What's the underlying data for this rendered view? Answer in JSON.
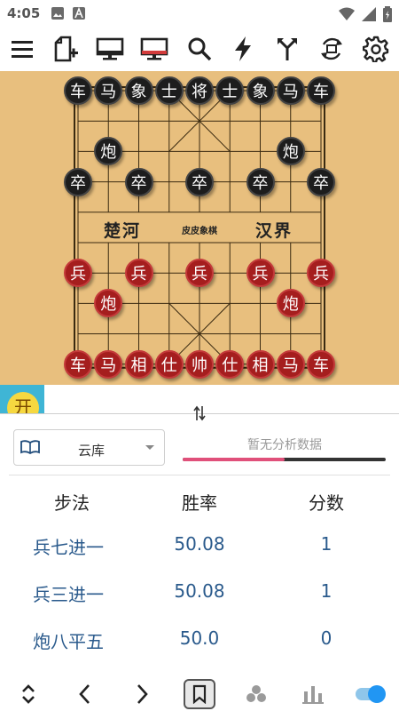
{
  "status_bar": {
    "time": "4:05",
    "left_icons": [
      "image-icon",
      "letter-a-icon"
    ],
    "right_icons": [
      "wifi-icon",
      "signal-icon",
      "battery-icon"
    ]
  },
  "toolbar": {
    "icons": [
      "menu-icon",
      "new-game-icon",
      "monitor-icon",
      "monitor-red-icon",
      "search-icon",
      "bolt-icon",
      "branch-icon",
      "rotate-icon",
      "gear-icon"
    ]
  },
  "board": {
    "river_left": "楚河",
    "river_right": "汉界",
    "river_center": "皮皮象棋",
    "black_pieces": [
      {
        "label": "车",
        "file": 0,
        "rank": 0
      },
      {
        "label": "马",
        "file": 1,
        "rank": 0
      },
      {
        "label": "象",
        "file": 2,
        "rank": 0
      },
      {
        "label": "士",
        "file": 3,
        "rank": 0
      },
      {
        "label": "将",
        "file": 4,
        "rank": 0
      },
      {
        "label": "士",
        "file": 5,
        "rank": 0
      },
      {
        "label": "象",
        "file": 6,
        "rank": 0
      },
      {
        "label": "马",
        "file": 7,
        "rank": 0
      },
      {
        "label": "车",
        "file": 8,
        "rank": 0
      },
      {
        "label": "炮",
        "file": 1,
        "rank": 2
      },
      {
        "label": "炮",
        "file": 7,
        "rank": 2
      },
      {
        "label": "卒",
        "file": 0,
        "rank": 3
      },
      {
        "label": "卒",
        "file": 2,
        "rank": 3
      },
      {
        "label": "卒",
        "file": 4,
        "rank": 3
      },
      {
        "label": "卒",
        "file": 6,
        "rank": 3
      },
      {
        "label": "卒",
        "file": 8,
        "rank": 3
      }
    ],
    "red_pieces": [
      {
        "label": "兵",
        "file": 0,
        "rank": 6
      },
      {
        "label": "兵",
        "file": 2,
        "rank": 6
      },
      {
        "label": "兵",
        "file": 4,
        "rank": 6
      },
      {
        "label": "兵",
        "file": 6,
        "rank": 6
      },
      {
        "label": "兵",
        "file": 8,
        "rank": 6
      },
      {
        "label": "炮",
        "file": 1,
        "rank": 7
      },
      {
        "label": "炮",
        "file": 7,
        "rank": 7
      },
      {
        "label": "车",
        "file": 0,
        "rank": 9
      },
      {
        "label": "马",
        "file": 1,
        "rank": 9
      },
      {
        "label": "相",
        "file": 2,
        "rank": 9
      },
      {
        "label": "仕",
        "file": 3,
        "rank": 9
      },
      {
        "label": "帅",
        "file": 4,
        "rank": 9
      },
      {
        "label": "仕",
        "file": 5,
        "rank": 9
      },
      {
        "label": "相",
        "file": 6,
        "rank": 9
      },
      {
        "label": "马",
        "file": 7,
        "rank": 9
      },
      {
        "label": "车",
        "file": 8,
        "rank": 9
      }
    ]
  },
  "mode_badge": {
    "label": "开"
  },
  "engine": {
    "label": "云库",
    "analysis_status": "暂无分析数据",
    "progress": 0.5,
    "progress_color": "#e0507a"
  },
  "table": {
    "headers": {
      "move": "步法",
      "winrate": "胜率",
      "score": "分数"
    },
    "rows": [
      {
        "move": "兵七进一",
        "winrate": "50.08",
        "score": "1"
      },
      {
        "move": "兵三进一",
        "winrate": "50.08",
        "score": "1"
      },
      {
        "move": "炮八平五",
        "winrate": "50.0",
        "score": "0"
      }
    ]
  },
  "bottom_nav": {
    "icons": [
      "expand-collapse-icon",
      "prev-icon",
      "next-icon",
      "bookmark-icon",
      "cluster-icon",
      "bar-chart-icon",
      "toggle-switch"
    ]
  },
  "colors": {
    "board": "#e8bf7e",
    "red_piece": "#a51e1e",
    "black_piece": "#1d1d1d",
    "accent_blue": "#2196f3",
    "badge_bg": "#3fb5d5",
    "link_blue": "#2a5a8c"
  }
}
